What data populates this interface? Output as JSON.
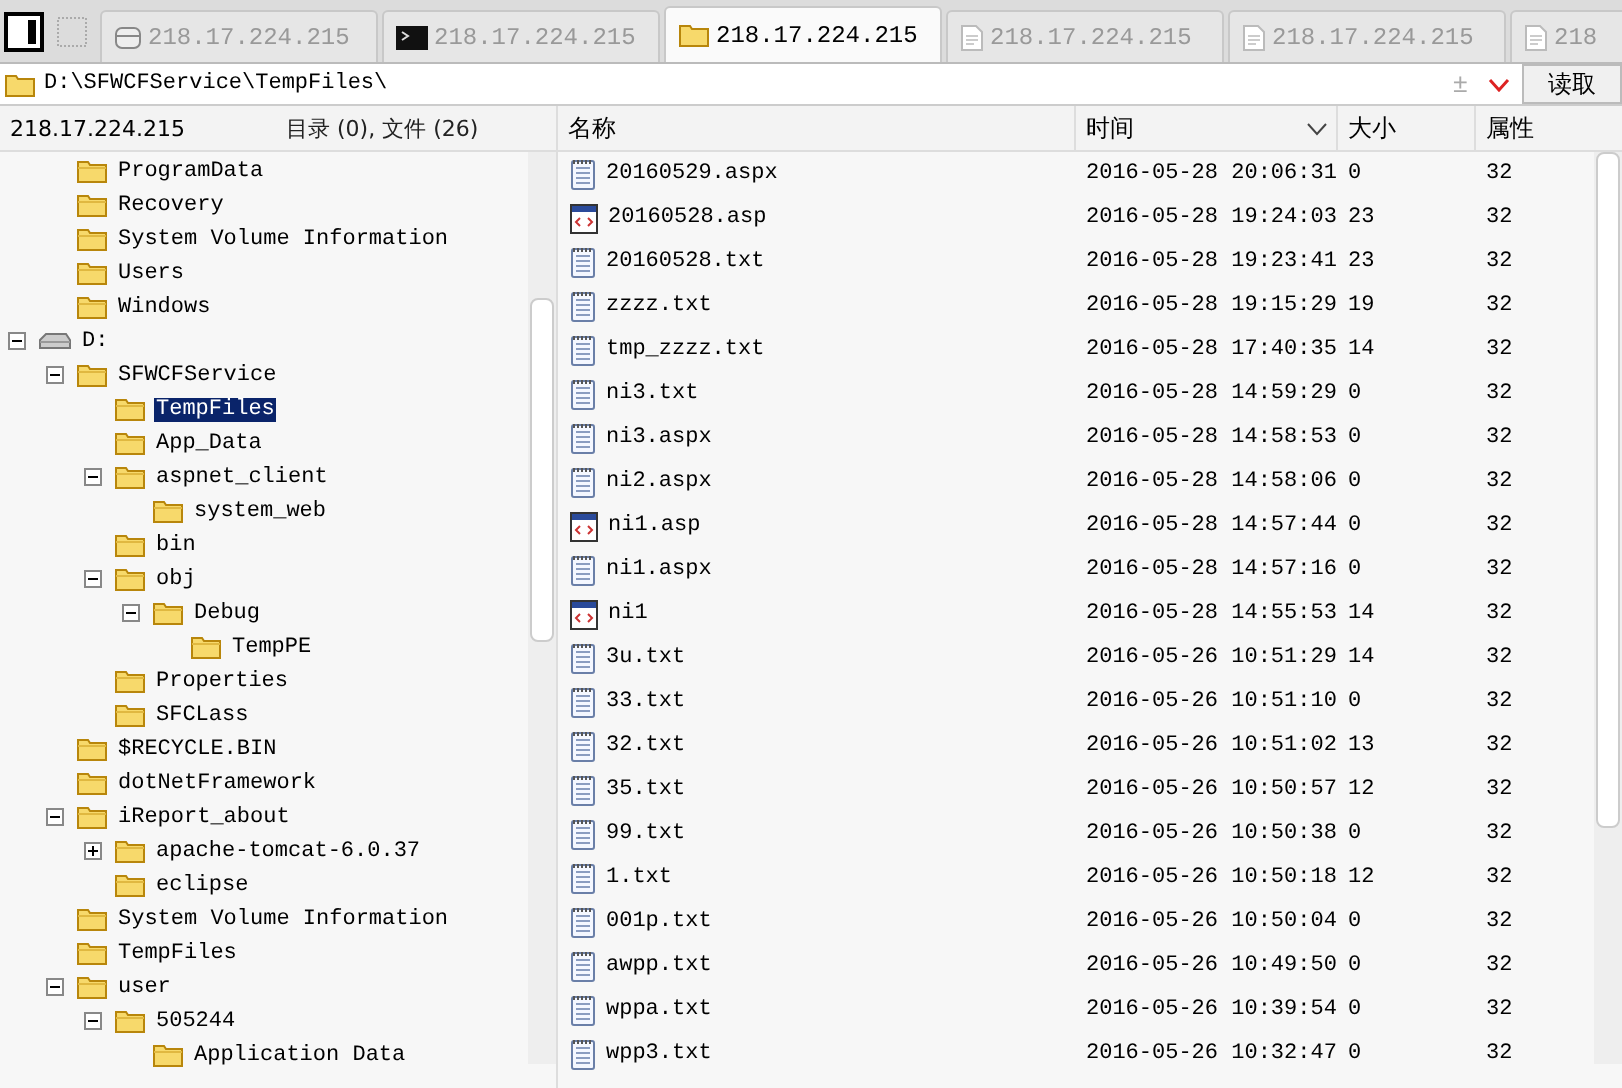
{
  "tabs": [
    {
      "label": "218.17.224.215",
      "kind": "disk",
      "selected": false
    },
    {
      "label": "218.17.224.215",
      "kind": "terminal",
      "selected": false
    },
    {
      "label": "218.17.224.215",
      "kind": "folder",
      "selected": true
    },
    {
      "label": "218.17.224.215",
      "kind": "doc",
      "selected": false
    },
    {
      "label": "218.17.224.215",
      "kind": "doc",
      "selected": false
    },
    {
      "label": "218",
      "kind": "doc",
      "selected": false
    }
  ],
  "path_bar": {
    "value": "D:\\SFWCFService\\TempFiles\\",
    "toggle": "±",
    "button": "读取"
  },
  "header": {
    "host": "218.17.224.215",
    "summary": "目录 (0), 文件 (26)"
  },
  "tree": [
    {
      "kind": "offscreen",
      "children": [
        {
          "kind": "folder",
          "label": "ProgramData",
          "selected": false
        },
        {
          "kind": "folder",
          "label": "Recovery",
          "selected": false
        },
        {
          "kind": "folder",
          "label": "System Volume Information",
          "selected": false
        },
        {
          "kind": "folder",
          "label": "Users",
          "selected": false
        },
        {
          "kind": "folder",
          "label": "Windows",
          "selected": false
        }
      ]
    },
    {
      "kind": "drive",
      "label": "D:",
      "selected": false,
      "expanded": true,
      "children": [
        {
          "kind": "folder",
          "label": "SFWCFService",
          "selected": false,
          "expanded": true,
          "children": [
            {
              "kind": "folder",
              "label": "TempFiles",
              "selected": true
            },
            {
              "kind": "folder",
              "label": "App_Data",
              "selected": false
            },
            {
              "kind": "folder",
              "label": "aspnet_client",
              "selected": false,
              "expanded": true,
              "children": [
                {
                  "kind": "folder",
                  "label": "system_web",
                  "selected": false
                }
              ]
            },
            {
              "kind": "folder",
              "label": "bin",
              "selected": false
            },
            {
              "kind": "folder",
              "label": "obj",
              "selected": false,
              "expanded": true,
              "children": [
                {
                  "kind": "folder",
                  "label": "Debug",
                  "selected": false,
                  "expanded": true,
                  "children": [
                    {
                      "kind": "folder",
                      "label": "TempPE",
                      "selected": false
                    }
                  ]
                }
              ]
            },
            {
              "kind": "folder",
              "label": "Properties",
              "selected": false
            },
            {
              "kind": "folder",
              "label": "SFCLass",
              "selected": false
            }
          ]
        },
        {
          "kind": "folder",
          "label": "$RECYCLE.BIN",
          "selected": false
        },
        {
          "kind": "folder",
          "label": "dotNetFramework",
          "selected": false
        },
        {
          "kind": "folder",
          "label": "iReport_about",
          "selected": false,
          "expanded": true,
          "children": [
            {
              "kind": "folder",
              "label": "apache-tomcat-6.0.37",
              "selected": false,
              "expanded": false
            },
            {
              "kind": "folder",
              "label": "eclipse",
              "selected": false
            }
          ]
        },
        {
          "kind": "folder",
          "label": "System Volume Information",
          "selected": false
        },
        {
          "kind": "folder",
          "label": "TempFiles",
          "selected": false
        },
        {
          "kind": "folder",
          "label": "user",
          "selected": false,
          "expanded": true,
          "children": [
            {
              "kind": "folder",
              "label": "505244",
              "selected": false,
              "expanded": true,
              "children": [
                {
                  "kind": "folder",
                  "label": "Application Data",
                  "selected": false
                }
              ]
            }
          ]
        }
      ]
    }
  ],
  "columns": [
    {
      "label": "名称",
      "sorted": false
    },
    {
      "label": "时间",
      "sorted": true
    },
    {
      "label": "大小",
      "sorted": false
    },
    {
      "label": "属性",
      "sorted": false
    }
  ],
  "files": [
    {
      "kind": "text",
      "name": "20160529.aspx",
      "time": "2016-05-28 20:06:31",
      "size": "0",
      "attr": "32"
    },
    {
      "kind": "script",
      "name": "20160528.asp",
      "time": "2016-05-28 19:24:03",
      "size": "23",
      "attr": "32"
    },
    {
      "kind": "text",
      "name": "20160528.txt",
      "time": "2016-05-28 19:23:41",
      "size": "23",
      "attr": "32"
    },
    {
      "kind": "text",
      "name": "zzzz.txt",
      "time": "2016-05-28 19:15:29",
      "size": "19",
      "attr": "32"
    },
    {
      "kind": "text",
      "name": "tmp_zzzz.txt",
      "time": "2016-05-28 17:40:35",
      "size": "14",
      "attr": "32"
    },
    {
      "kind": "text",
      "name": "ni3.txt",
      "time": "2016-05-28 14:59:29",
      "size": "0",
      "attr": "32"
    },
    {
      "kind": "text",
      "name": "ni3.aspx",
      "time": "2016-05-28 14:58:53",
      "size": "0",
      "attr": "32"
    },
    {
      "kind": "text",
      "name": "ni2.aspx",
      "time": "2016-05-28 14:58:06",
      "size": "0",
      "attr": "32"
    },
    {
      "kind": "script",
      "name": "ni1.asp",
      "time": "2016-05-28 14:57:44",
      "size": "0",
      "attr": "32"
    },
    {
      "kind": "text",
      "name": "ni1.aspx",
      "time": "2016-05-28 14:57:16",
      "size": "0",
      "attr": "32"
    },
    {
      "kind": "script",
      "name": "ni1",
      "time": "2016-05-28 14:55:53",
      "size": "14",
      "attr": "32"
    },
    {
      "kind": "text",
      "name": "3u.txt",
      "time": "2016-05-26 10:51:29",
      "size": "14",
      "attr": "32"
    },
    {
      "kind": "text",
      "name": "33.txt",
      "time": "2016-05-26 10:51:10",
      "size": "0",
      "attr": "32"
    },
    {
      "kind": "text",
      "name": "32.txt",
      "time": "2016-05-26 10:51:02",
      "size": "13",
      "attr": "32"
    },
    {
      "kind": "text",
      "name": "35.txt",
      "time": "2016-05-26 10:50:57",
      "size": "12",
      "attr": "32"
    },
    {
      "kind": "text",
      "name": "99.txt",
      "time": "2016-05-26 10:50:38",
      "size": "0",
      "attr": "32"
    },
    {
      "kind": "text",
      "name": "1.txt",
      "time": "2016-05-26 10:50:18",
      "size": "12",
      "attr": "32"
    },
    {
      "kind": "text",
      "name": "001p.txt",
      "time": "2016-05-26 10:50:04",
      "size": "0",
      "attr": "32"
    },
    {
      "kind": "text",
      "name": "awpp.txt",
      "time": "2016-05-26 10:49:50",
      "size": "0",
      "attr": "32"
    },
    {
      "kind": "text",
      "name": "wppa.txt",
      "time": "2016-05-26 10:39:54",
      "size": "0",
      "attr": "32"
    },
    {
      "kind": "text",
      "name": "wpp3.txt",
      "time": "2016-05-26 10:32:47",
      "size": "0",
      "attr": "32"
    }
  ]
}
